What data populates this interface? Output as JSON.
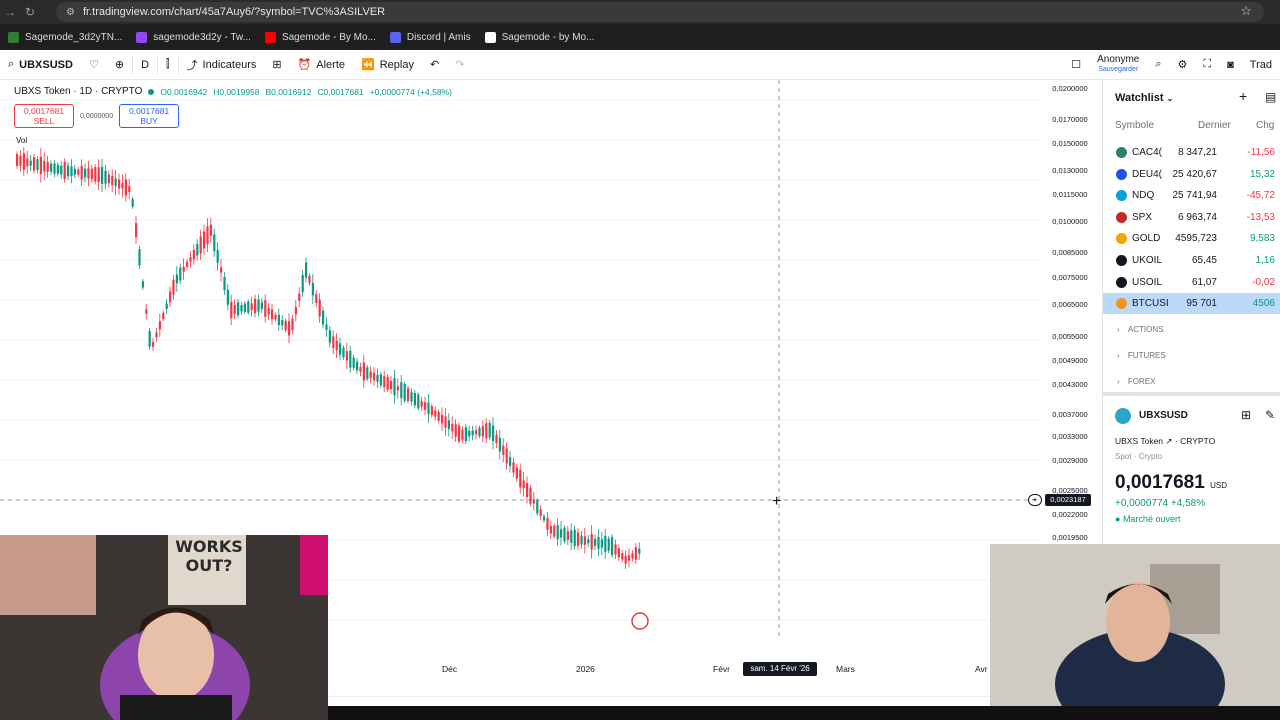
{
  "browser": {
    "url": "fr.tradingview.com/chart/45a7Auy6/?symbol=TVC%3ASILVER",
    "bookmarks": [
      {
        "label": "Sagemode_3d2yTN...",
        "color": "#2e7d32"
      },
      {
        "label": "sagemode3d2y - Tw...",
        "color": "#9146ff"
      },
      {
        "label": "Sagemode - By Mo...",
        "color": "#ff0000"
      },
      {
        "label": "Discord | Amis",
        "color": "#5865f2"
      },
      {
        "label": "Sagemode - by Mo...",
        "color": "#ffffff"
      }
    ]
  },
  "toolbar": {
    "symbol": "UBXSUSD",
    "interval": "D",
    "indicators": "Indicateurs",
    "alert": "Alerte",
    "replay": "Replay",
    "user": "Anonyme",
    "user_sub": "Sauvegarder",
    "trade": "Trad"
  },
  "legend": {
    "title": "UBXS Token · 1D · CRYPTO",
    "open": "O0,0016942",
    "high": "H0,0019958",
    "low": "B0,0016912",
    "close": "C0,0017681",
    "change": "+0,0000774 (+4,58%)",
    "sell_price": "0,0017681",
    "sell_label": "SELL",
    "spread": "0,0000000",
    "buy_price": "0,0017681",
    "buy_label": "BUY",
    "vol": "Vol"
  },
  "price_axis": [
    "0,0200000",
    "0,0170000",
    "0,0150000",
    "0,0130000",
    "0,0115000",
    "0,0100000",
    "0,0085000",
    "0,0075000",
    "0,0065000",
    "0,0055000",
    "0,0049000",
    "0,0043000",
    "0,0037000",
    "0,0033000",
    "0,0029000",
    "0,0025000",
    "0,0022000",
    "0,0019500"
  ],
  "crosshair": {
    "price": "0,0023187",
    "time": "sam. 14 Févr '26"
  },
  "time_axis": [
    "Déc",
    "2026",
    "Févr",
    "Mars",
    "Avr"
  ],
  "watchlist": {
    "title": "Watchlist",
    "col_symbol": "Symbole",
    "col_last": "Dernier",
    "col_chg": "Chg",
    "rows": [
      {
        "sym": "CAC4(",
        "last": "8 347,21",
        "chg": "-11,56",
        "color": "#f23645",
        "icon": "#2e7d6f"
      },
      {
        "sym": "DEU4(",
        "last": "25 420,67",
        "chg": "15,32",
        "color": "#089981",
        "icon": "#1e53e5"
      },
      {
        "sym": "NDQ",
        "last": "25 741,94",
        "chg": "-45,72",
        "color": "#f23645",
        "icon": "#00a3e0"
      },
      {
        "sym": "SPX",
        "last": "6 963,74",
        "chg": "-13,53",
        "color": "#f23645",
        "icon": "#c62828"
      },
      {
        "sym": "GOLD",
        "last": "4595,723",
        "chg": "9,583",
        "color": "#089981",
        "icon": "#f4a300"
      },
      {
        "sym": "UKOIL",
        "last": "65,45",
        "chg": "1,16",
        "color": "#089981",
        "icon": "#131722"
      },
      {
        "sym": "USOIL",
        "last": "61,07",
        "chg": "-0,02",
        "color": "#f23645",
        "icon": "#131722"
      },
      {
        "sym": "BTCUSI",
        "last": "95 701",
        "chg": "4506",
        "color": "#089981",
        "icon": "#f7931a"
      }
    ],
    "sections": [
      "ACTIONS",
      "FUTURES",
      "FOREX"
    ]
  },
  "detail": {
    "symbol": "UBXSUSD",
    "name": "UBXS Token",
    "exchange": "CRYPTO",
    "type": "Spot · Crypto",
    "price": "0,0017681",
    "currency": "USD",
    "change": "+0,0000774 +4,58%",
    "status": "Marché ouvert"
  },
  "webcam_text": "WORKS OUT?"
}
